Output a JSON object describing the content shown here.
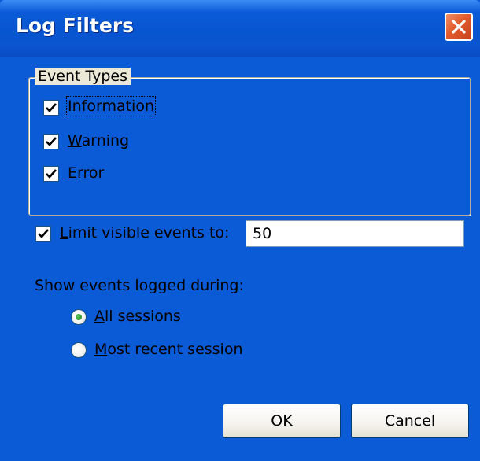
{
  "window": {
    "title": "Log Filters"
  },
  "event_types": {
    "legend": "Event Types",
    "items": [
      {
        "label": "Information",
        "checked": true
      },
      {
        "label": "Warning",
        "checked": true
      },
      {
        "label": "Error",
        "checked": true
      }
    ]
  },
  "limit": {
    "label": "Limit visible events to:",
    "checked": true,
    "value": "50"
  },
  "sessions": {
    "label": "Show events logged during:",
    "options": [
      {
        "label": "All sessions",
        "selected": true
      },
      {
        "label": "Most recent session",
        "selected": false
      }
    ]
  },
  "buttons": {
    "ok": "OK",
    "cancel": "Cancel"
  },
  "colors": {
    "titlebar": "#0a5ad7",
    "face": "#ece9d8",
    "close": "#e25a2b"
  }
}
